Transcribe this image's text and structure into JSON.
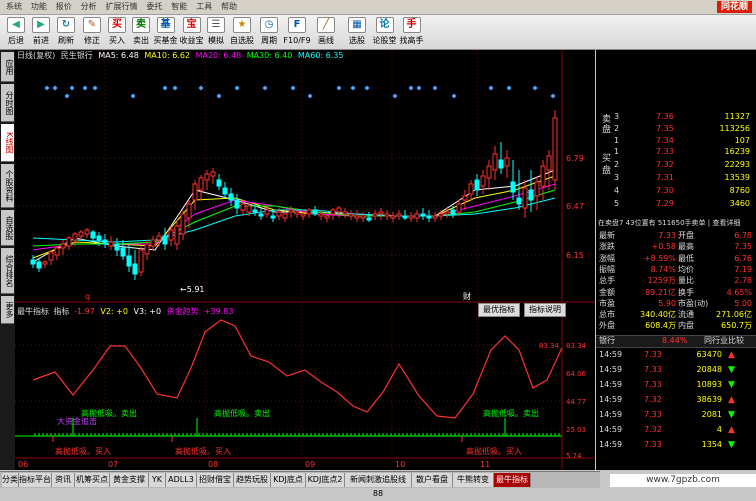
{
  "menu": {
    "items": [
      "系统",
      "功能",
      "报价",
      "分析",
      "扩展行情",
      "委托",
      "智能",
      "工具",
      "帮助"
    ],
    "brand": "同花顺"
  },
  "toolbar": {
    "buttons": [
      {
        "label": "后退",
        "icon": "◀"
      },
      {
        "label": "前进",
        "icon": "▶"
      },
      {
        "label": "刷新",
        "icon": "↻"
      },
      {
        "label": "修正",
        "icon": "✎"
      },
      {
        "label": "买入",
        "icon": "买"
      },
      {
        "label": "卖出",
        "icon": "卖"
      },
      {
        "label": "买基金",
        "icon": "基"
      },
      {
        "label": "收益宝",
        "icon": "宝"
      },
      {
        "label": "模拟",
        "icon": "☰"
      },
      {
        "label": "自选股",
        "icon": "★"
      },
      {
        "label": "周期",
        "icon": "◷"
      },
      {
        "label": "F10/F9",
        "icon": "F"
      },
      {
        "label": "画线",
        "icon": "╱"
      },
      {
        "label": "选股",
        "icon": "▦"
      },
      {
        "label": "论股堂",
        "icon": "论"
      },
      {
        "label": "找高手",
        "icon": "手"
      }
    ]
  },
  "left_tabs": [
    "应用",
    "分时图",
    "K线图",
    "个股资料",
    "自选股",
    "综合排名",
    "更多"
  ],
  "chart": {
    "cycle": "日线(复权)",
    "stock": "民生银行",
    "ma": [
      {
        "label": "MA5: 6.48",
        "color": "#ffffff"
      },
      {
        "label": "MA10: 6.62",
        "color": "#ffff00"
      },
      {
        "label": "MA20: 6.48",
        "color": "#ff00ff"
      },
      {
        "label": "MA30: 6.40",
        "color": "#00ff00"
      },
      {
        "label": "MA60: 6.35",
        "color": "#00ffff"
      }
    ],
    "price_ticks": [
      "6.79",
      "6.47",
      "6.15"
    ],
    "low_label": "5.91",
    "date_ticks": [
      "06",
      "07",
      "08",
      "09",
      "10",
      "11"
    ],
    "markers": [
      "q",
      "财"
    ]
  },
  "indicator": {
    "name": "最牛指标",
    "desc": "指标",
    "diff": "-1.97",
    "v2": "V2: +0",
    "v3": "V3: +0",
    "funds": "资金趋势: +39.83",
    "ticks": [
      "83.34",
      "64.06",
      "44.77",
      "25.03",
      "5.74"
    ],
    "labels": [
      "高抛低吸。卖出",
      "高抛低吸。卖出",
      "高抛低吸。卖出",
      "高抛低吸。买入",
      "高抛低吸。买入",
      "高抛低吸。买入",
      "大资金追击"
    ],
    "btn_optimize": "最优指标",
    "btn_desc": "指标说明"
  },
  "quote": {
    "sell_label": "卖盘",
    "buy_label": "买盘",
    "asks": [
      {
        "lvl": "3",
        "price": "7.36",
        "vol": "11327"
      },
      {
        "lvl": "2",
        "price": "7.35",
        "vol": "113256"
      },
      {
        "lvl": "1",
        "price": "7.34",
        "vol": "107"
      }
    ],
    "bids": [
      {
        "lvl": "1",
        "price": "7.33",
        "vol": "16239"
      },
      {
        "lvl": "2",
        "price": "7.32",
        "vol": "22293"
      },
      {
        "lvl": "3",
        "price": "7.31",
        "vol": "13539"
      },
      {
        "lvl": "4",
        "price": "7.30",
        "vol": "8760"
      },
      {
        "lvl": "5",
        "price": "7.29",
        "vol": "3460"
      }
    ],
    "book_line": "在卖盘7 43位置有 511650手卖单 | 查看详细",
    "rows": [
      {
        "l": "最新",
        "v": "7.33",
        "l2": "开盘",
        "v2": "6.78"
      },
      {
        "l": "涨跌",
        "v": "+0.58",
        "l2": "最高",
        "v2": "7.35"
      },
      {
        "l": "涨幅",
        "v": "+8.59%",
        "l2": "最低",
        "v2": "6.76"
      },
      {
        "l": "振幅",
        "v": "8.74%",
        "l2": "均价",
        "v2": "7.19"
      },
      {
        "l": "总手",
        "v": "1259万",
        "l2": "量比",
        "v2": "2.78"
      },
      {
        "l": "金额",
        "v": "89.21亿",
        "l2": "换手",
        "v2": "4.65%"
      },
      {
        "l": "市盈",
        "v": "5.90",
        "l2": "市盈(动)",
        "v2": "5.00"
      },
      {
        "l": "总市",
        "v": "340.40亿",
        "l2": "流通",
        "v2": "271.06亿"
      },
      {
        "l": "外盘",
        "v": "608.4万",
        "l2": "内盘",
        "v2": "650.7万"
      }
    ],
    "sector": "银行",
    "sector_pct": "8.44%",
    "sector_link": "同行业比较",
    "ticks": [
      {
        "t": "14:59",
        "p": "7.33",
        "v": "63470",
        "d": "up"
      },
      {
        "t": "14:59",
        "p": "7.33",
        "v": "20848",
        "d": "down"
      },
      {
        "t": "14:59",
        "p": "7.33",
        "v": "10893",
        "d": "down"
      },
      {
        "t": "14:59",
        "p": "7.32",
        "v": "38639",
        "d": "up"
      },
      {
        "t": "14:59",
        "p": "7.33",
        "v": "2081",
        "d": "down"
      },
      {
        "t": "14:59",
        "p": "7.32",
        "v": "4",
        "d": "up"
      },
      {
        "t": "14:59",
        "p": "7.33",
        "v": "1354",
        "d": "down"
      }
    ]
  },
  "bottom_tabs": [
    "分类",
    "指标平台",
    "资讯",
    "机筹买点",
    "黄金支撑",
    "YK",
    "ADLL3",
    "招财借宝",
    "趋势玩股",
    "KDJ底点",
    "KDJ底点2",
    "新闻刺激追股线88",
    "散户看盘",
    "牛熊转变",
    "最牛指标"
  ],
  "watermark": "www.7gpzb.com",
  "colors": {
    "up": "#ff3030",
    "down": "#00ff00",
    "text": "#ffffff",
    "yellow": "#ffff00",
    "cyan": "#00ffff"
  }
}
